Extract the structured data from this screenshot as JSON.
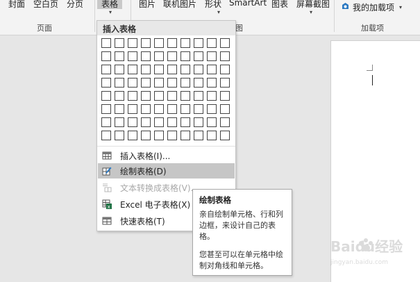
{
  "ribbon": {
    "items": [
      "封面",
      "空白页",
      "分页",
      "表格",
      "图片",
      "联机图片",
      "形状",
      "SmartArt",
      "图表",
      "屏幕截图",
      "我的加载项"
    ],
    "groups": {
      "pages": "页面",
      "illustrations_tail": "图",
      "addins": "加载项"
    }
  },
  "dropdown": {
    "header": "插入表格",
    "grid": {
      "cols": 10,
      "rows": 8
    },
    "menu": [
      {
        "label": "插入表格(I)...",
        "state": "normal",
        "icon": "table-icon"
      },
      {
        "label": "绘制表格(D)",
        "state": "hover",
        "icon": "pencil-table-icon"
      },
      {
        "label": "文本转换成表格(V)...",
        "state": "disabled",
        "icon": "text-to-table-icon"
      },
      {
        "label": "Excel 电子表格(X)",
        "state": "normal",
        "icon": "excel-table-icon"
      },
      {
        "label": "快速表格(T)",
        "state": "normal",
        "icon": "quick-table-icon"
      }
    ]
  },
  "tooltip": {
    "title": "绘制表格",
    "para1": "亲自绘制单元格、行和列边框，来设计自己的表格。",
    "para2": "您甚至可以在单元格中绘制对角线和单元格。"
  },
  "watermark": {
    "text": "Baidu经验",
    "sub": "jingyan.baidu.com"
  },
  "colors": {
    "ribbon_bg": "#f3f3f3",
    "hover_bg": "#c6c6c6",
    "header_bg": "#e8e8e8",
    "workspace": "#e6e6e6",
    "addin_blue": "#2b79c2",
    "excel_green": "#217346"
  }
}
